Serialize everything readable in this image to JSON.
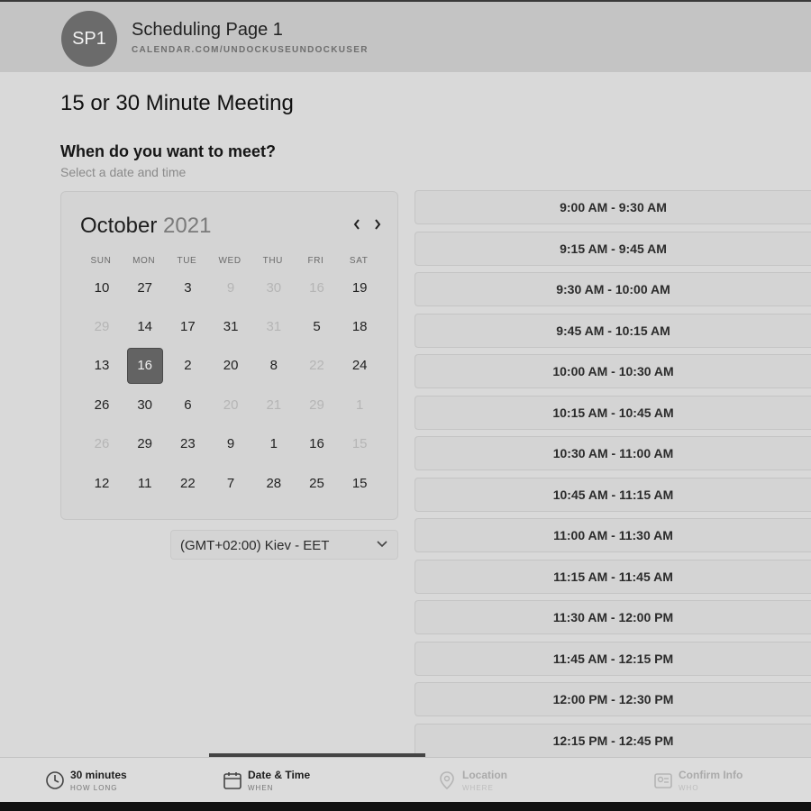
{
  "header": {
    "avatar_initials": "SP1",
    "page_name": "Scheduling Page 1",
    "url": "CALENDAR.COM/UNDOCKUSEUNDOCKUSER"
  },
  "meeting": {
    "title": "15 or 30 Minute Meeting",
    "question": "When do you want to meet?",
    "subtitle": "Select a date and time"
  },
  "calendar": {
    "month": "October",
    "year": "2021",
    "prev_icon": "chevron-left-icon",
    "next_icon": "chevron-right-icon",
    "weekdays": [
      "SUN",
      "MON",
      "TUE",
      "WED",
      "THU",
      "FRI",
      "SAT"
    ],
    "weeks": [
      [
        {
          "label": "10",
          "state": "active"
        },
        {
          "label": "27",
          "state": "active"
        },
        {
          "label": "3",
          "state": "active"
        },
        {
          "label": "9",
          "state": "muted"
        },
        {
          "label": "30",
          "state": "muted"
        },
        {
          "label": "16",
          "state": "muted"
        },
        {
          "label": "19",
          "state": "active"
        }
      ],
      [
        {
          "label": "29",
          "state": "muted"
        },
        {
          "label": "14",
          "state": "active"
        },
        {
          "label": "17",
          "state": "active"
        },
        {
          "label": "31",
          "state": "active"
        },
        {
          "label": "31",
          "state": "muted"
        },
        {
          "label": "5",
          "state": "active"
        },
        {
          "label": "18",
          "state": "active"
        }
      ],
      [
        {
          "label": "13",
          "state": "active"
        },
        {
          "label": "16",
          "state": "selected"
        },
        {
          "label": "2",
          "state": "active"
        },
        {
          "label": "20",
          "state": "active"
        },
        {
          "label": "8",
          "state": "active"
        },
        {
          "label": "22",
          "state": "muted"
        },
        {
          "label": "24",
          "state": "active"
        }
      ],
      [
        {
          "label": "26",
          "state": "active"
        },
        {
          "label": "30",
          "state": "active"
        },
        {
          "label": "6",
          "state": "active"
        },
        {
          "label": "20",
          "state": "muted"
        },
        {
          "label": "21",
          "state": "muted"
        },
        {
          "label": "29",
          "state": "muted"
        },
        {
          "label": "1",
          "state": "muted"
        }
      ],
      [
        {
          "label": "26",
          "state": "muted"
        },
        {
          "label": "29",
          "state": "active"
        },
        {
          "label": "23",
          "state": "active"
        },
        {
          "label": "9",
          "state": "active"
        },
        {
          "label": "1",
          "state": "active"
        },
        {
          "label": "16",
          "state": "active"
        },
        {
          "label": "15",
          "state": "muted"
        }
      ],
      [
        {
          "label": "12",
          "state": "active"
        },
        {
          "label": "11",
          "state": "active"
        },
        {
          "label": "22",
          "state": "active"
        },
        {
          "label": "7",
          "state": "active"
        },
        {
          "label": "28",
          "state": "active"
        },
        {
          "label": "25",
          "state": "active"
        },
        {
          "label": "15",
          "state": "active"
        }
      ]
    ]
  },
  "timezone": {
    "label": "(GMT+02:00) Kiev - EET",
    "icon": "chevron-down-icon"
  },
  "time_slots": [
    "9:00 AM - 9:30 AM",
    "9:15 AM - 9:45 AM",
    "9:30 AM - 10:00 AM",
    "9:45 AM - 10:15 AM",
    "10:00 AM - 10:30 AM",
    "10:15 AM - 10:45 AM",
    "10:30 AM - 11:00 AM",
    "10:45 AM - 11:15 AM",
    "11:00 AM - 11:30 AM",
    "11:15 AM - 11:45 AM",
    "11:30 AM - 12:00 PM",
    "11:45 AM - 12:15 PM",
    "12:00 PM - 12:30 PM",
    "12:15 PM - 12:45 PM"
  ],
  "footer": {
    "progress": 1.0,
    "steps": [
      {
        "label": "30 minutes",
        "sub": "HOW LONG",
        "icon": "clock-icon",
        "state": "done"
      },
      {
        "label": "Date & Time",
        "sub": "WHEN",
        "icon": "calendar-icon",
        "state": "done"
      },
      {
        "label": "Location",
        "sub": "WHERE",
        "icon": "map-pin-icon",
        "state": "future"
      },
      {
        "label": "Confirm Info",
        "sub": "WHO",
        "icon": "user-card-icon",
        "state": "future"
      }
    ]
  },
  "colors": {
    "background": "#d9d9d9",
    "header": "#c4c4c4",
    "avatar": "#6b6b6b",
    "selected_day": "#636363"
  }
}
